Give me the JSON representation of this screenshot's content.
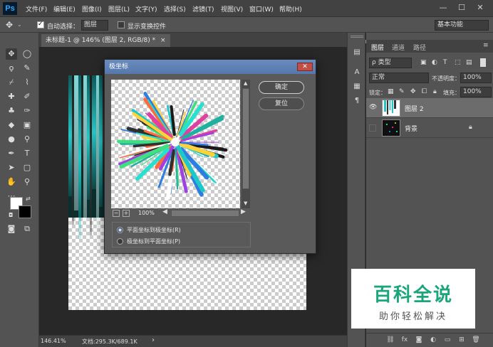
{
  "app": {
    "logo": "Ps"
  },
  "menu": [
    "文件(F)",
    "编辑(E)",
    "图像(I)",
    "图层(L)",
    "文字(Y)",
    "选择(S)",
    "滤镜(T)",
    "视图(V)",
    "窗口(W)",
    "帮助(H)"
  ],
  "window_controls": [
    "—",
    "☐",
    "✕"
  ],
  "options": {
    "auto_select_label": "自动选择：",
    "auto_select_target": "图层",
    "transform_controls_label": "显示变换控件",
    "workspace": "基本功能"
  },
  "document": {
    "tab_title": "未标题-1 @ 146% (图层 2, RGB/8) *",
    "close": "×",
    "zoom": "146.41%",
    "doc_size": "文档:295.3K/689.1K",
    "status_arrow": "›"
  },
  "dialog": {
    "title": "极坐标",
    "close": "✕",
    "ok": "确定",
    "reset": "复位",
    "zoom_minus": "−",
    "zoom_plus": "+",
    "zoom_value": "100%",
    "radio_rect_to_polar": "平面坐标到极坐标(R)",
    "radio_polar_to_rect": "极坐标到平面坐标(P)",
    "selected_option": "rect_to_polar"
  },
  "panel": {
    "tabs": [
      "图层",
      "通道",
      "路径"
    ],
    "filter_kind": "ρ 类型",
    "blend_mode": "正常",
    "opacity_label": "不透明度：",
    "opacity_value": "100%",
    "lock_label": "锁定：",
    "fill_label": "填充：",
    "fill_value": "100%",
    "layers": [
      {
        "name": "图层 2",
        "selected": true,
        "visible": true
      },
      {
        "name": "背景",
        "selected": false,
        "visible": false,
        "locked": true
      }
    ],
    "bottom_icons": [
      "link-icon",
      "fx-icon",
      "mask-icon",
      "adjustment-icon",
      "folder-icon",
      "new-layer-icon",
      "trash-icon"
    ]
  },
  "watermark": {
    "main": "百科全说",
    "sub": "助你轻松解决"
  }
}
